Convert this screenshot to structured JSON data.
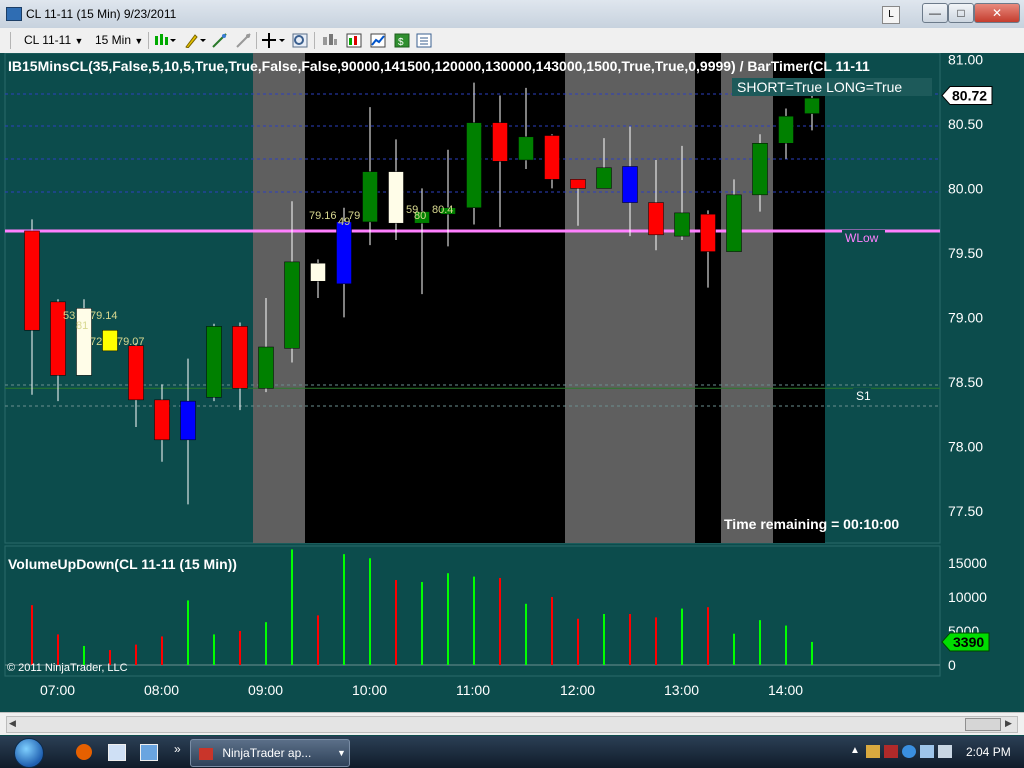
{
  "window": {
    "title": "CL 11-11 (15 Min)  9/23/2011",
    "link_button": "L",
    "min": "—",
    "max": "□",
    "close": "✕"
  },
  "toolbar": {
    "instrument": "CL 11-11",
    "interval": "15 Min"
  },
  "chart": {
    "indicator_title": "IB15MinsCL(35,False,5,10,5,True,True,False,False,90000,141500,120000,130000,143000,1500,True,True,0,9999)  /  BarTimer(CL  11-11",
    "signal_text": "SHORT=True LONG=True",
    "last_price": "80.72",
    "time_remaining": "Time remaining = 00:10:00",
    "wlow_label": "WLow",
    "s1_label": "S1",
    "copyright": "© 2011 NinjaTrader, LLC",
    "volume_title": "VolumeUpDown(CL 11-11 (15 Min))",
    "last_volume": "3390",
    "annotations": [
      "53",
      "79.14",
      "81",
      "72",
      "79.07",
      "79.16",
      "79",
      "49",
      "59",
      "80.4",
      "80"
    ]
  },
  "chart_data": {
    "type": "candlestick",
    "price_axis": {
      "range": [
        77.25,
        81.05
      ],
      "ticks": [
        "81.00",
        "80.50",
        "80.00",
        "79.50",
        "79.00",
        "78.50",
        "78.00",
        "77.50"
      ]
    },
    "volume_axis": {
      "range": [
        0,
        17500
      ],
      "ticks": [
        "15000",
        "10000",
        "5000",
        "0"
      ]
    },
    "time_ticks": [
      "07:00",
      "08:00",
      "09:00",
      "10:00",
      "11:00",
      "12:00",
      "13:00",
      "14:00"
    ],
    "candles": [
      {
        "o": 79.67,
        "h": 79.76,
        "l": 78.4,
        "c": 78.9,
        "color": "#ff0000"
      },
      {
        "o": 79.12,
        "h": 79.14,
        "l": 78.35,
        "c": 78.55,
        "color": "#ff0000"
      },
      {
        "o": 78.55,
        "h": 79.14,
        "l": 78.55,
        "c": 79.07,
        "color": "#fffde8"
      },
      {
        "o": 78.9,
        "h": 78.9,
        "l": 78.75,
        "c": 78.74,
        "color": "#ffff00"
      },
      {
        "o": 78.78,
        "h": 78.8,
        "l": 78.15,
        "c": 78.36,
        "color": "#ff0000"
      },
      {
        "o": 78.36,
        "h": 78.48,
        "l": 77.88,
        "c": 78.05,
        "color": "#ff0000"
      },
      {
        "o": 78.05,
        "h": 78.68,
        "l": 77.55,
        "c": 78.35,
        "color": "#0000ff"
      },
      {
        "o": 78.38,
        "h": 78.95,
        "l": 78.35,
        "c": 78.93,
        "color": "#008000"
      },
      {
        "o": 78.93,
        "h": 78.96,
        "l": 78.28,
        "c": 78.45,
        "color": "#ff0000"
      },
      {
        "o": 78.45,
        "h": 79.15,
        "l": 78.42,
        "c": 78.77,
        "color": "#008000"
      },
      {
        "o": 78.76,
        "h": 79.9,
        "l": 78.65,
        "c": 79.43,
        "color": "#008000"
      },
      {
        "o": 79.28,
        "h": 79.45,
        "l": 79.15,
        "c": 79.42,
        "color": "#fffde8"
      },
      {
        "o": 79.26,
        "h": 79.85,
        "l": 79.0,
        "c": 79.74,
        "color": "#0000ff"
      },
      {
        "o": 79.74,
        "h": 80.63,
        "l": 79.56,
        "c": 80.13,
        "color": "#008000"
      },
      {
        "o": 80.13,
        "h": 80.38,
        "l": 79.6,
        "c": 79.73,
        "color": "#fffde8"
      },
      {
        "o": 79.73,
        "h": 80.0,
        "l": 79.18,
        "c": 79.82,
        "color": "#008000"
      },
      {
        "o": 79.8,
        "h": 80.3,
        "l": 79.55,
        "c": 79.85,
        "color": "#008000"
      },
      {
        "o": 79.85,
        "h": 80.82,
        "l": 79.72,
        "c": 80.51,
        "color": "#008000"
      },
      {
        "o": 80.51,
        "h": 80.72,
        "l": 79.7,
        "c": 80.21,
        "color": "#ff0000"
      },
      {
        "o": 80.22,
        "h": 80.78,
        "l": 80.15,
        "c": 80.4,
        "color": "#008000"
      },
      {
        "o": 80.41,
        "h": 80.42,
        "l": 80.0,
        "c": 80.07,
        "color": "#ff0000"
      },
      {
        "o": 80.07,
        "h": 80.07,
        "l": 79.71,
        "c": 80.0,
        "color": "#ff0000"
      },
      {
        "o": 80.0,
        "h": 80.39,
        "l": 80.01,
        "c": 80.16,
        "color": "#008000"
      },
      {
        "o": 80.17,
        "h": 80.48,
        "l": 79.63,
        "c": 79.89,
        "color": "#0000ff"
      },
      {
        "o": 79.89,
        "h": 80.22,
        "l": 79.52,
        "c": 79.64,
        "color": "#ff0000"
      },
      {
        "o": 79.63,
        "h": 80.33,
        "l": 79.6,
        "c": 79.81,
        "color": "#008000"
      },
      {
        "o": 79.8,
        "h": 79.83,
        "l": 79.23,
        "c": 79.51,
        "color": "#ff0000"
      },
      {
        "o": 79.51,
        "h": 80.07,
        "l": 79.51,
        "c": 79.95,
        "color": "#008000"
      },
      {
        "o": 79.95,
        "h": 80.42,
        "l": 79.82,
        "c": 80.35,
        "color": "#008000"
      },
      {
        "o": 80.35,
        "h": 80.62,
        "l": 80.23,
        "c": 80.56,
        "color": "#008000"
      },
      {
        "o": 80.58,
        "h": 80.75,
        "l": 80.45,
        "c": 80.7,
        "color": "#008000"
      }
    ],
    "volume": [
      {
        "v": 8800,
        "color": "#ff0000"
      },
      {
        "v": 4500,
        "color": "#ff0000"
      },
      {
        "v": 2800,
        "color": "#00ff00"
      },
      {
        "v": 2200,
        "color": "#ff0000"
      },
      {
        "v": 3000,
        "color": "#ff0000"
      },
      {
        "v": 4200,
        "color": "#ff0000"
      },
      {
        "v": 9500,
        "color": "#00ff00"
      },
      {
        "v": 4500,
        "color": "#00ff00"
      },
      {
        "v": 5000,
        "color": "#ff0000"
      },
      {
        "v": 6300,
        "color": "#00ff00"
      },
      {
        "v": 17000,
        "color": "#00ff00"
      },
      {
        "v": 7300,
        "color": "#ff0000"
      },
      {
        "v": 16300,
        "color": "#00ff00"
      },
      {
        "v": 15700,
        "color": "#00ff00"
      },
      {
        "v": 12500,
        "color": "#ff0000"
      },
      {
        "v": 12200,
        "color": "#00ff00"
      },
      {
        "v": 13500,
        "color": "#00ff00"
      },
      {
        "v": 13000,
        "color": "#00ff00"
      },
      {
        "v": 12800,
        "color": "#ff0000"
      },
      {
        "v": 9000,
        "color": "#00ff00"
      },
      {
        "v": 10000,
        "color": "#ff0000"
      },
      {
        "v": 6800,
        "color": "#ff0000"
      },
      {
        "v": 7500,
        "color": "#00ff00"
      },
      {
        "v": 7500,
        "color": "#ff0000"
      },
      {
        "v": 7000,
        "color": "#ff0000"
      },
      {
        "v": 8300,
        "color": "#00ff00"
      },
      {
        "v": 8500,
        "color": "#ff0000"
      },
      {
        "v": 4600,
        "color": "#00ff00"
      },
      {
        "v": 6600,
        "color": "#00ff00"
      },
      {
        "v": 5800,
        "color": "#00ff00"
      },
      {
        "v": 3390,
        "color": "#00ff00"
      }
    ],
    "levels": [
      {
        "name": "WLow",
        "value": 79.67,
        "color": "#ff80ff"
      },
      {
        "name": "S1",
        "value": 78.45,
        "color": "#2b7a2b"
      }
    ]
  },
  "taskbar": {
    "task_label": "NinjaTrader ap...",
    "clock": "2:04 PM"
  }
}
